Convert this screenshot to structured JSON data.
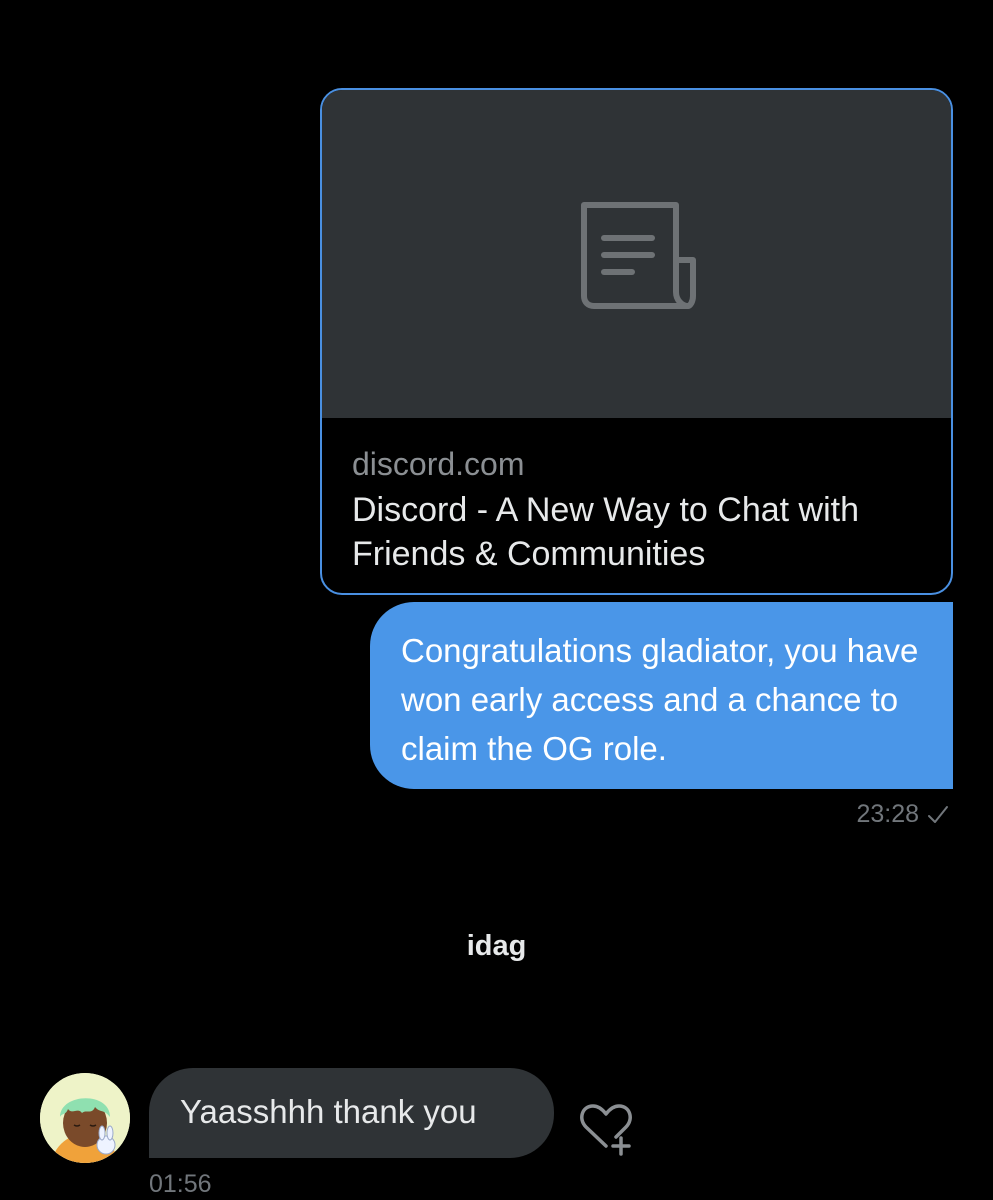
{
  "link_preview": {
    "domain": "discord.com",
    "title": "Discord - A New Way to Chat with Friends & Communities",
    "icon": "document-icon"
  },
  "outgoing_message": {
    "text": "Congratulations gladiator, you have won early access and a chance to claim the OG role.",
    "time": "23:28",
    "status_icon": "check-icon"
  },
  "sender": {
    "name": "idag"
  },
  "incoming_message": {
    "text": "Yaasshhh thank you",
    "time": "01:56",
    "reaction_icon": "heart-plus-icon"
  },
  "colors": {
    "background": "#000000",
    "outgoing_bubble": "#4a96e8",
    "incoming_bubble": "#2f3336",
    "card_border": "#4a90e2",
    "muted_text": "#71767b"
  }
}
